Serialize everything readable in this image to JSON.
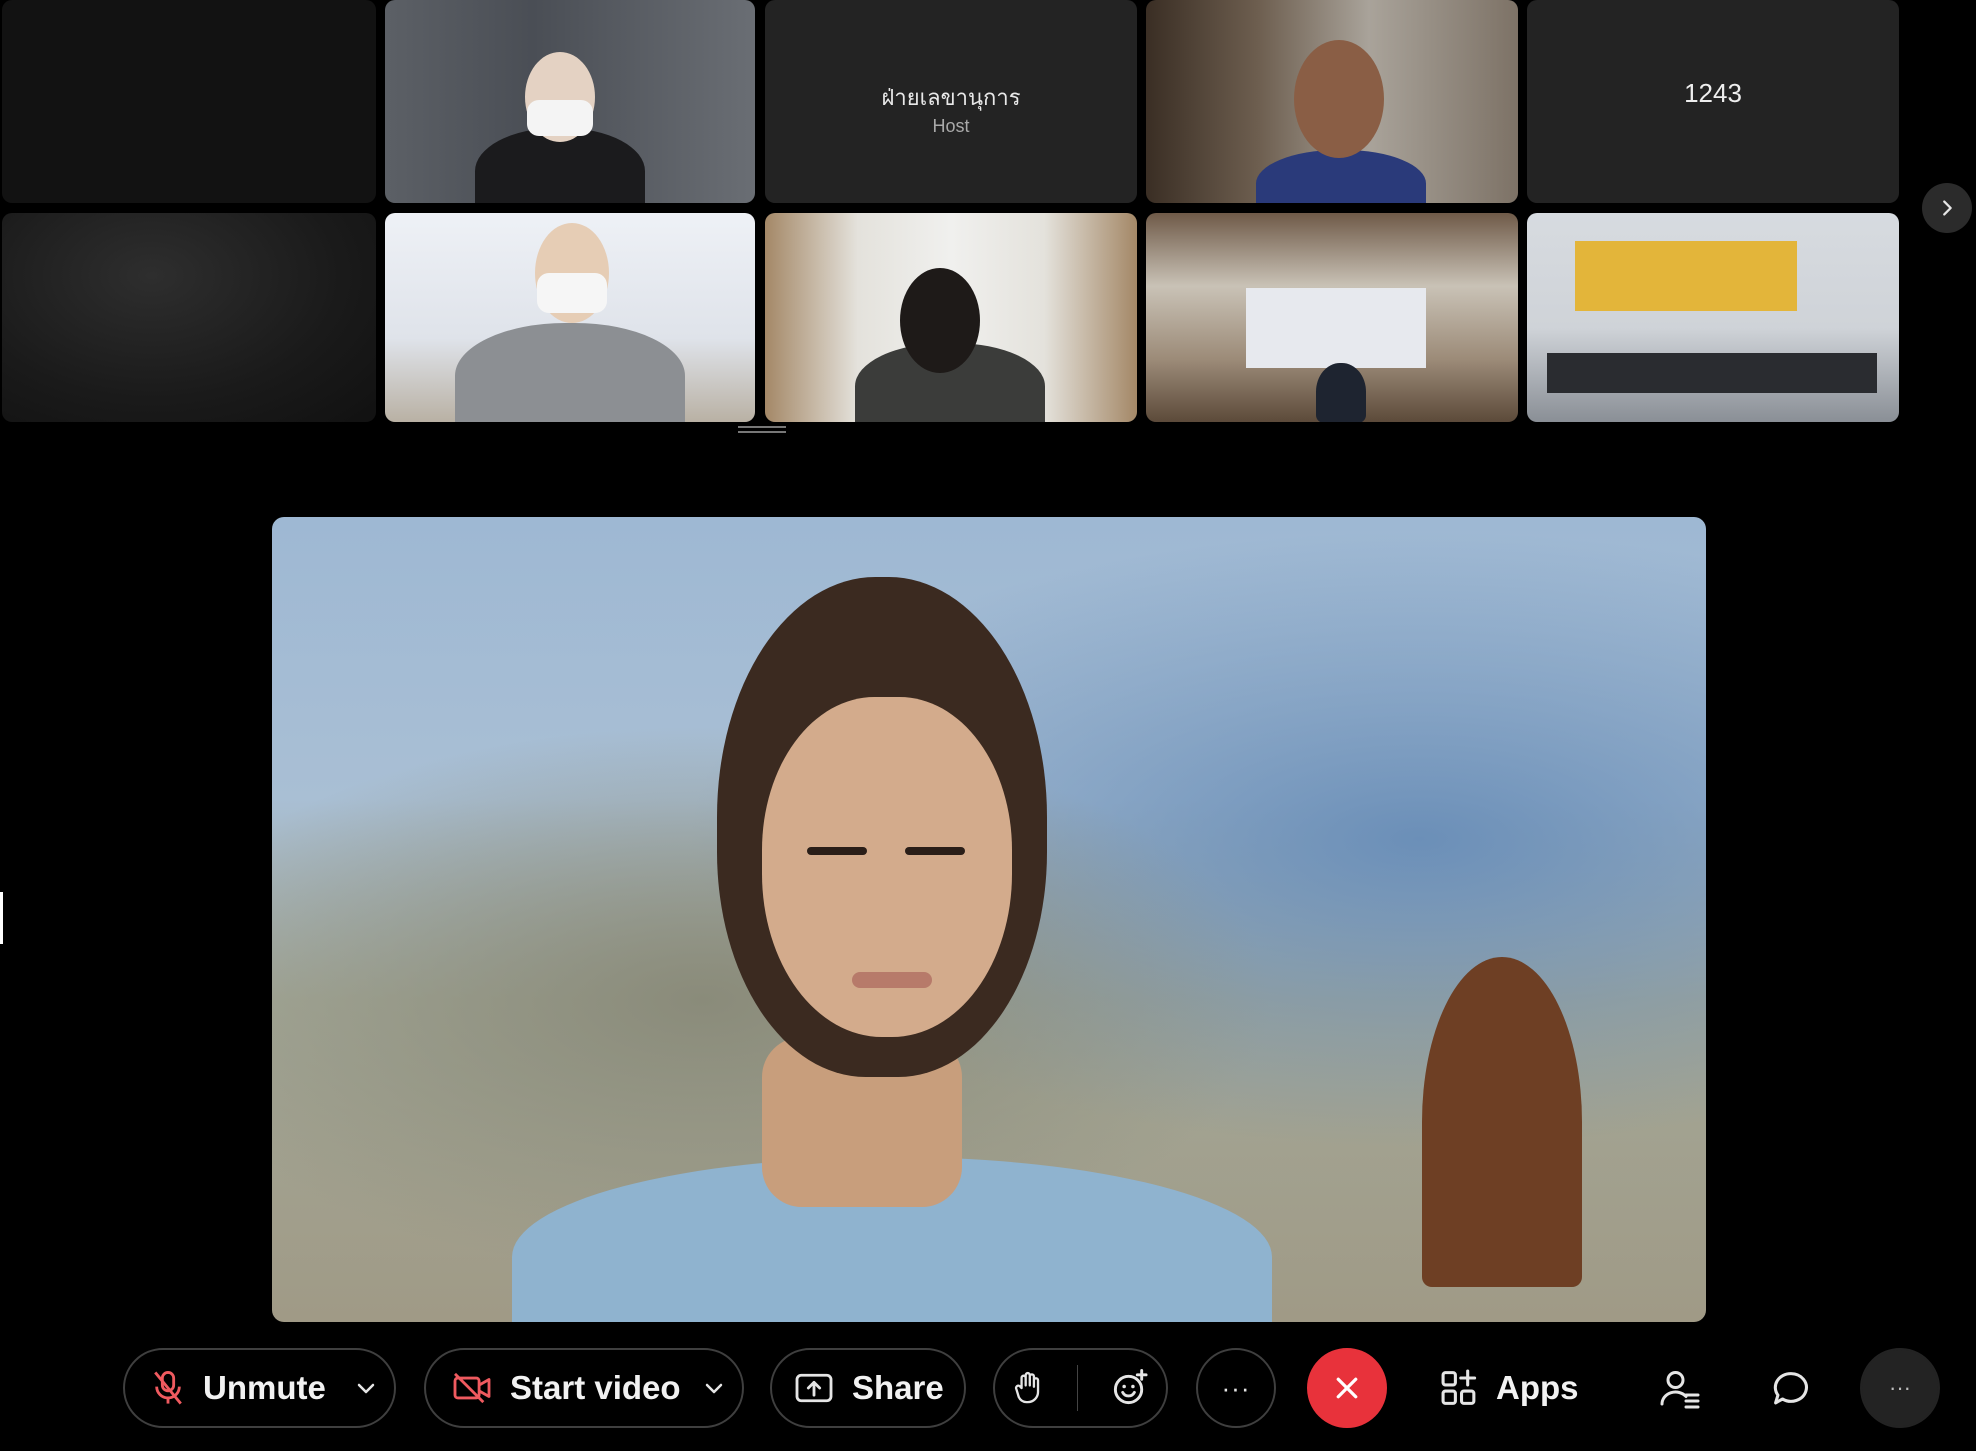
{
  "participants": {
    "host_tile": {
      "name": "ฝ่ายเลขานุการ",
      "role": "Host"
    },
    "numbered_tile": {
      "label": "1243"
    }
  },
  "toolbar": {
    "unmute_label": "Unmute",
    "start_video_label": "Start video",
    "share_label": "Share",
    "more_label": "···",
    "apps_label": "Apps",
    "overflow_label": "···"
  },
  "colors": {
    "end_call": "#e8323b",
    "muted_icon": "#ef5a5f",
    "tile_background": "#232323"
  }
}
